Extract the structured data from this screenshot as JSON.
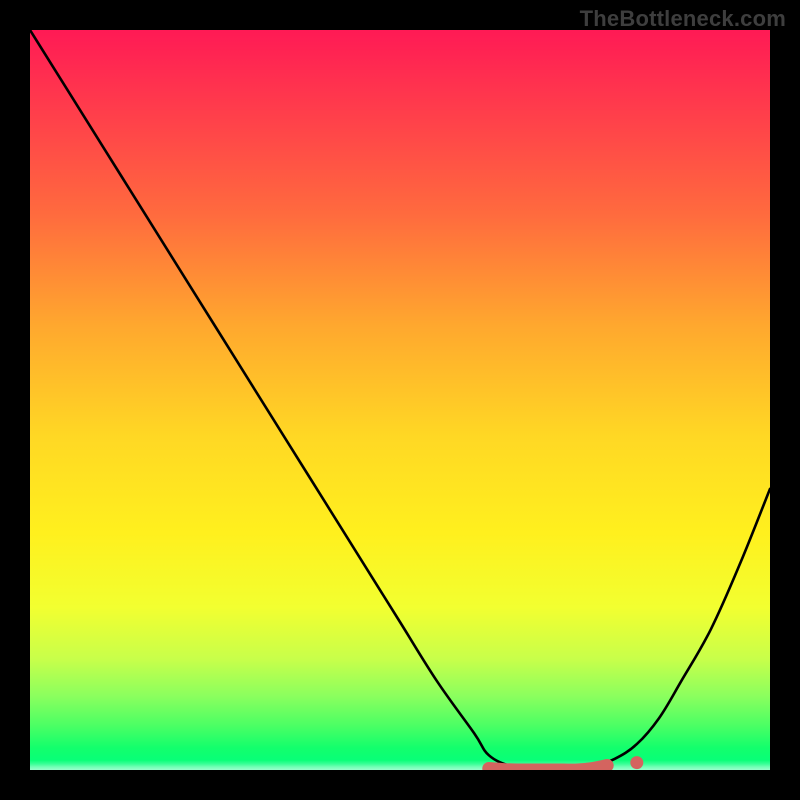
{
  "watermark": "TheBottleneck.com",
  "chart_data": {
    "type": "line",
    "title": "",
    "xlabel": "",
    "ylabel": "",
    "xlim": [
      0,
      100
    ],
    "ylim": [
      0,
      100
    ],
    "grid": false,
    "legend": false,
    "series": [
      {
        "name": "main-curve",
        "color": "#000000",
        "x": [
          0,
          5,
          10,
          15,
          20,
          25,
          30,
          35,
          40,
          45,
          50,
          55,
          60,
          62,
          65,
          68,
          70,
          73,
          76,
          79,
          82,
          85,
          88,
          92,
          96,
          100
        ],
        "values": [
          100,
          92,
          84,
          76,
          68,
          60,
          52,
          44,
          36,
          28,
          20,
          12,
          5,
          2,
          0.5,
          0,
          0,
          0,
          0.5,
          1.5,
          3.5,
          7,
          12,
          19,
          28,
          38
        ]
      },
      {
        "name": "bottom-marker",
        "color": "#d4645f",
        "x": [
          62,
          64,
          66,
          68,
          70,
          72,
          74,
          76,
          78
        ],
        "values": [
          0.2,
          0.05,
          0,
          0,
          0,
          0,
          0,
          0.2,
          0.6
        ],
        "style": "thick-rounded"
      },
      {
        "name": "bottom-dot",
        "color": "#d4645f",
        "x": [
          82
        ],
        "values": [
          1.0
        ],
        "style": "dot"
      }
    ],
    "background_gradient": {
      "top": "#ff1a55",
      "mid": "#ffe41e",
      "bottom": "#00ff80"
    }
  }
}
